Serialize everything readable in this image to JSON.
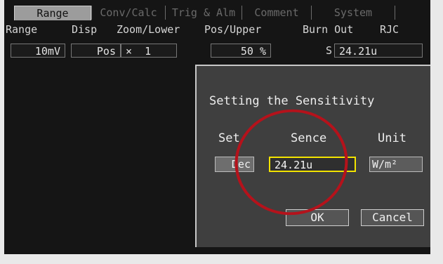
{
  "tabs": [
    {
      "label": "Range",
      "active": true
    },
    {
      "label": "Conv/Calc",
      "active": false
    },
    {
      "label": "Trig & Alm",
      "active": false
    },
    {
      "label": "Comment",
      "active": false
    },
    {
      "label": "System",
      "active": false
    }
  ],
  "columns": {
    "range": "Range",
    "disp": "Disp",
    "zoom_lower": "Zoom/Lower",
    "pos_upper": "Pos/Upper",
    "burn_out": "Burn Out",
    "rjc": "RJC"
  },
  "values": {
    "range": "10mV",
    "disp": "Pos",
    "zoom": "×  1",
    "pos_upper": "50 %",
    "burn_out": "S",
    "rjc": "24.21u"
  },
  "dialog": {
    "title": "Setting the Sensitivity",
    "set_label": "Set",
    "sence_label": "Sence",
    "unit_label": "Unit",
    "set_value": "Dec",
    "sence_value": "24.21u",
    "unit_value": "W/m²",
    "ok_label": "OK",
    "cancel_label": "Cancel"
  },
  "colors": {
    "highlight_border": "#f2e300",
    "annotation_circle": "#b5121b"
  }
}
